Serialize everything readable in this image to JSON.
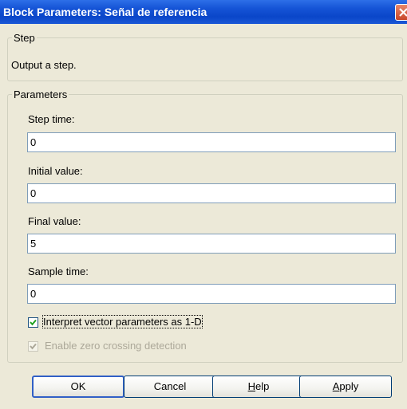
{
  "window": {
    "title": "Block Parameters: Señal de  referencia"
  },
  "step_group": {
    "legend": "Step",
    "description": "Output a step."
  },
  "parameters_group": {
    "legend": "Parameters",
    "fields": [
      {
        "label": "Step time:",
        "value": "0"
      },
      {
        "label": "Initial value:",
        "value": "0"
      },
      {
        "label": "Final value:",
        "value": "5"
      },
      {
        "label": "Sample time:",
        "value": "0"
      }
    ],
    "interpret_vector": {
      "label": "Interpret vector parameters as 1-D",
      "checked": true
    },
    "zero_crossing": {
      "label": "Enable zero crossing detection",
      "checked": true,
      "disabled": true
    }
  },
  "buttons": {
    "ok": "OK",
    "cancel": "Cancel",
    "help_mnemonic": "H",
    "help_rest": "elp",
    "apply_mnemonic": "A",
    "apply_rest": "pply"
  },
  "colors": {
    "titlebar": "#0a46c9",
    "dialog_bg": "#ece9d8",
    "close_button": "#c84528"
  }
}
